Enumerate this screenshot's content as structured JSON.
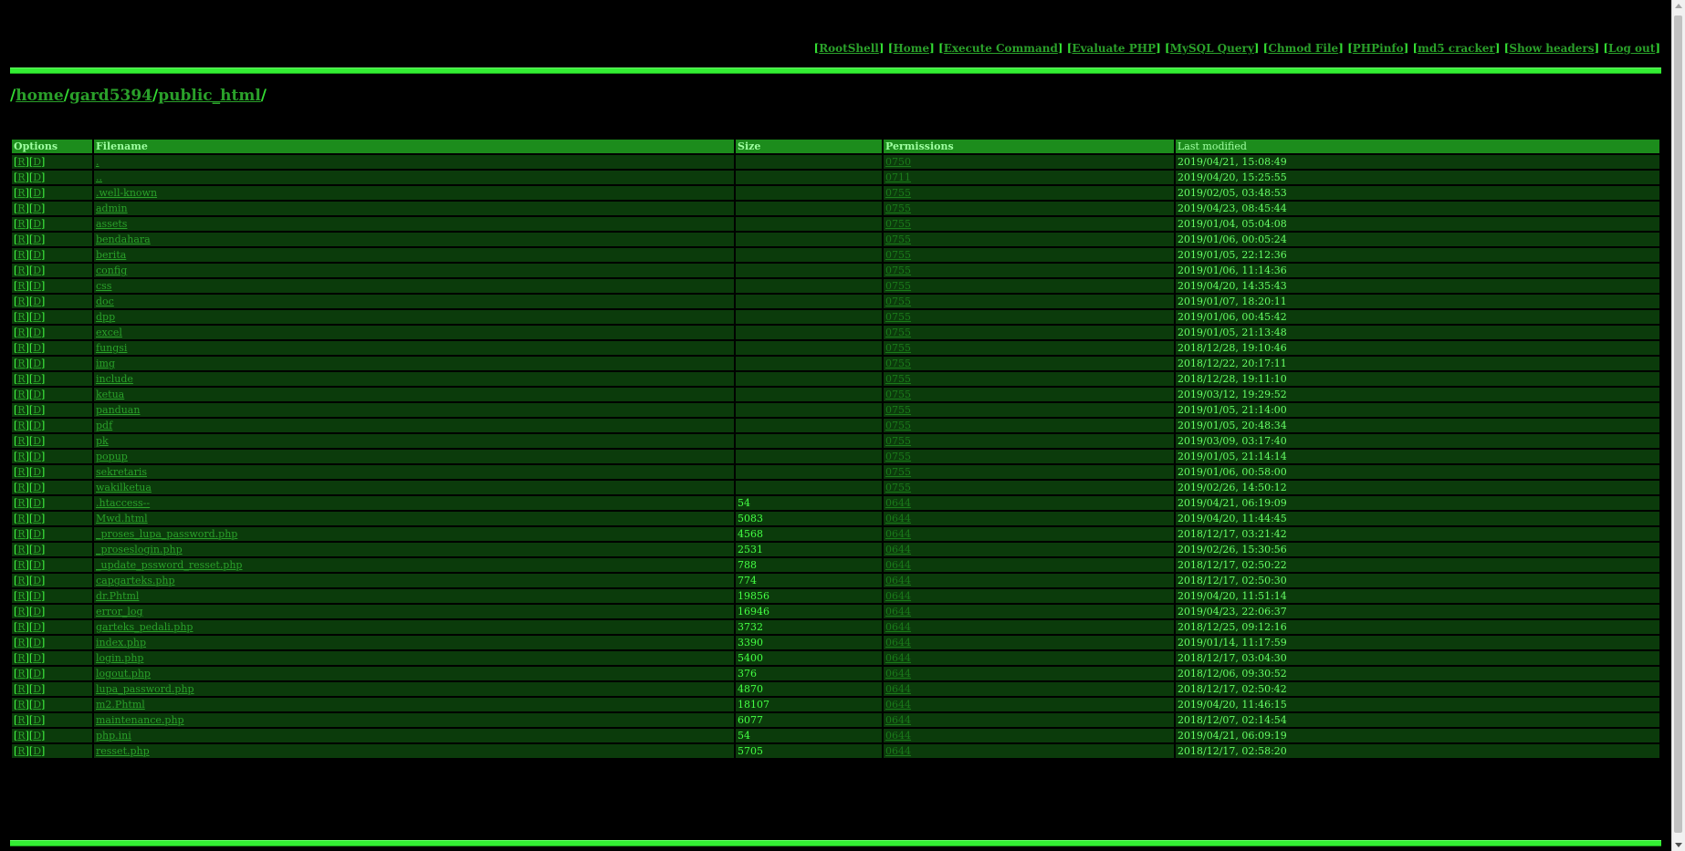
{
  "nav": {
    "links": [
      "RootShell",
      "Home",
      "Execute Command",
      "Evaluate PHP",
      "MySQL Query",
      "Chmod File",
      "PHPinfo",
      "md5 cracker",
      "Show headers",
      "Log out"
    ]
  },
  "path": {
    "parts": [
      "home",
      "gard5394",
      "public_html"
    ]
  },
  "table": {
    "headers": [
      "Options",
      "Filename",
      "Size",
      "Permissions",
      "Last modified"
    ],
    "action_rename": "R",
    "action_delete": "D",
    "rows": [
      {
        "name": ".",
        "size": "",
        "perm": "0750",
        "date": "2019/04/21, 15:08:49"
      },
      {
        "name": "..",
        "size": "",
        "perm": "0711",
        "date": "2019/04/20, 15:25:55"
      },
      {
        "name": ".well-known",
        "size": "",
        "perm": "0755",
        "date": "2019/02/05, 03:48:53"
      },
      {
        "name": "admin",
        "size": "",
        "perm": "0755",
        "date": "2019/04/23, 08:45:44"
      },
      {
        "name": "assets",
        "size": "",
        "perm": "0755",
        "date": "2019/01/04, 05:04:08"
      },
      {
        "name": "bendahara",
        "size": "",
        "perm": "0755",
        "date": "2019/01/06, 00:05:24"
      },
      {
        "name": "berita",
        "size": "",
        "perm": "0755",
        "date": "2019/01/05, 22:12:36"
      },
      {
        "name": "config",
        "size": "",
        "perm": "0755",
        "date": "2019/01/06, 11:14:36"
      },
      {
        "name": "css",
        "size": "",
        "perm": "0755",
        "date": "2019/04/20, 14:35:43"
      },
      {
        "name": "doc",
        "size": "",
        "perm": "0755",
        "date": "2019/01/07, 18:20:11"
      },
      {
        "name": "dpp",
        "size": "",
        "perm": "0755",
        "date": "2019/01/06, 00:45:42"
      },
      {
        "name": "excel",
        "size": "",
        "perm": "0755",
        "date": "2019/01/05, 21:13:48"
      },
      {
        "name": "fungsi",
        "size": "",
        "perm": "0755",
        "date": "2018/12/28, 19:10:46"
      },
      {
        "name": "img",
        "size": "",
        "perm": "0755",
        "date": "2018/12/22, 20:17:11"
      },
      {
        "name": "include",
        "size": "",
        "perm": "0755",
        "date": "2018/12/28, 19:11:10"
      },
      {
        "name": "ketua",
        "size": "",
        "perm": "0755",
        "date": "2019/03/12, 19:29:52"
      },
      {
        "name": "panduan",
        "size": "",
        "perm": "0755",
        "date": "2019/01/05, 21:14:00"
      },
      {
        "name": "pdf",
        "size": "",
        "perm": "0755",
        "date": "2019/01/05, 20:48:34"
      },
      {
        "name": "pk",
        "size": "",
        "perm": "0755",
        "date": "2019/03/09, 03:17:40"
      },
      {
        "name": "popup",
        "size": "",
        "perm": "0755",
        "date": "2019/01/05, 21:14:14"
      },
      {
        "name": "sekretaris",
        "size": "",
        "perm": "0755",
        "date": "2019/01/06, 00:58:00"
      },
      {
        "name": "wakilketua",
        "size": "",
        "perm": "0755",
        "date": "2019/02/26, 14:50:12"
      },
      {
        "name": ".htaccess--",
        "size": "54",
        "perm": "0644",
        "date": "2019/04/21, 06:19:09"
      },
      {
        "name": "Mwd.html",
        "size": "5083",
        "perm": "0644",
        "date": "2019/04/20, 11:44:45"
      },
      {
        "name": "_proses_lupa_password.php",
        "size": "4568",
        "perm": "0644",
        "date": "2018/12/17, 03:21:42"
      },
      {
        "name": "_proseslogin.php",
        "size": "2531",
        "perm": "0644",
        "date": "2019/02/26, 15:30:56"
      },
      {
        "name": "_update_pssword_resset.php",
        "size": "788",
        "perm": "0644",
        "date": "2018/12/17, 02:50:22"
      },
      {
        "name": "capgarteks.php",
        "size": "774",
        "perm": "0644",
        "date": "2018/12/17, 02:50:30"
      },
      {
        "name": "dr.Phtml",
        "size": "19856",
        "perm": "0644",
        "date": "2019/04/20, 11:51:14"
      },
      {
        "name": "error_log",
        "size": "16946",
        "perm": "0644",
        "date": "2019/04/23, 22:06:37"
      },
      {
        "name": "garteks_pedali.php",
        "size": "3732",
        "perm": "0644",
        "date": "2018/12/25, 09:12:16"
      },
      {
        "name": "index.php",
        "size": "3390",
        "perm": "0644",
        "date": "2019/01/14, 11:17:59"
      },
      {
        "name": "login.php",
        "size": "5400",
        "perm": "0644",
        "date": "2018/12/17, 03:04:30"
      },
      {
        "name": "logout.php",
        "size": "376",
        "perm": "0644",
        "date": "2018/12/06, 09:30:52"
      },
      {
        "name": "lupa_password.php",
        "size": "4870",
        "perm": "0644",
        "date": "2018/12/17, 02:50:42"
      },
      {
        "name": "m2.Phtml",
        "size": "18107",
        "perm": "0644",
        "date": "2019/04/20, 11:46:15"
      },
      {
        "name": "maintenance.php",
        "size": "6077",
        "perm": "0644",
        "date": "2018/12/07, 02:14:54"
      },
      {
        "name": "php.ini",
        "size": "54",
        "perm": "0644",
        "date": "2019/04/21, 06:09:19"
      },
      {
        "name": "resset.php",
        "size": "5705",
        "perm": "0644",
        "date": "2018/12/17, 02:58:20"
      }
    ]
  }
}
